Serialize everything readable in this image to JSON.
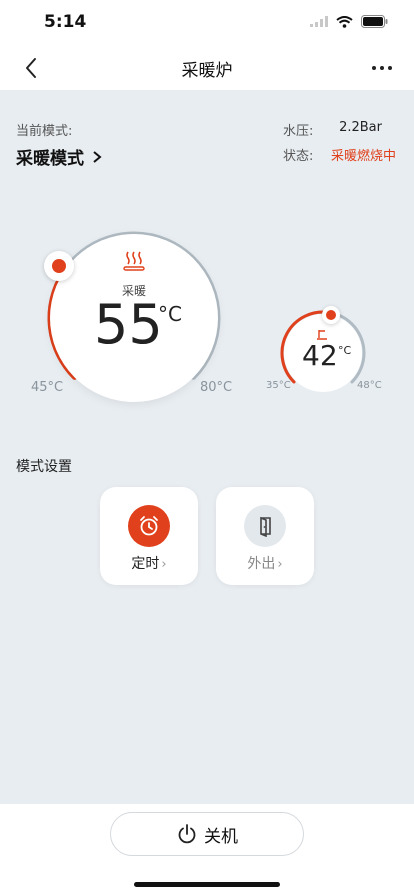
{
  "status_bar": {
    "time": "5:14"
  },
  "nav": {
    "title": "采暖炉"
  },
  "info": {
    "mode_label": "当前模式:",
    "mode_value": "采暖模式",
    "pressure_label": "水压:",
    "pressure_value": "2.2Bar",
    "status_label": "状态:",
    "status_value": "采暖燃烧中"
  },
  "heating_dial": {
    "label": "采暖",
    "temp": "55",
    "unit": "°C",
    "min": "45°C",
    "max": "80°C",
    "level": 0.286
  },
  "water_dial": {
    "temp": "42",
    "unit": "°C",
    "min": "35°C",
    "max": "48°C",
    "level": 0.54
  },
  "mode_settings": {
    "title": "模式设置",
    "items": [
      {
        "label": "定时",
        "icon": "alarm-clock-icon"
      },
      {
        "label": "外出",
        "icon": "door-exit-icon"
      }
    ]
  },
  "bottom": {
    "power_label": "关机",
    "icon": "power-icon"
  },
  "colors": {
    "accent": "#e0401b",
    "track": "#b0bbc3",
    "background": "#e8edf1"
  }
}
